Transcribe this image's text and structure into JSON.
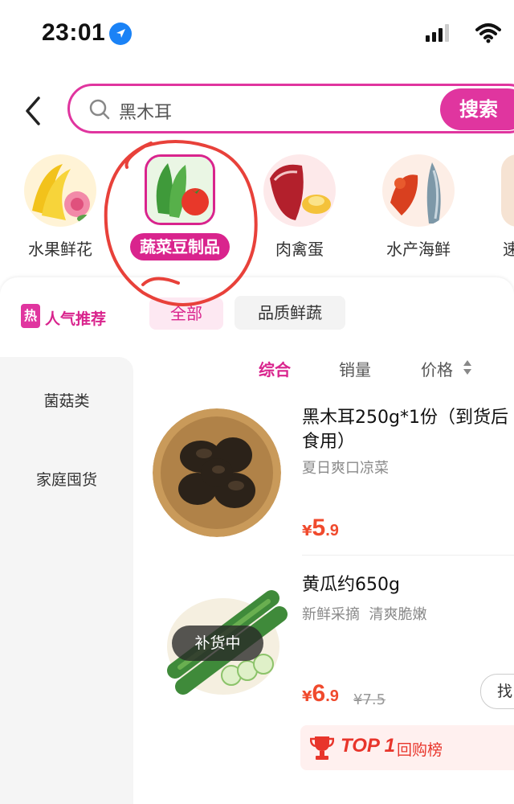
{
  "status_bar": {
    "time": "23:01"
  },
  "search": {
    "query": "黑木耳",
    "button_label": "搜索"
  },
  "categories": [
    {
      "label": "水果鲜花"
    },
    {
      "label": "蔬菜豆制品",
      "active": true
    },
    {
      "label": "肉禽蛋"
    },
    {
      "label": "水产海鲜"
    },
    {
      "label": "速"
    }
  ],
  "hot": {
    "badge": "热",
    "title": "人气推荐"
  },
  "tabs": [
    {
      "label": "全部",
      "active": true
    },
    {
      "label": "品质鲜蔬"
    }
  ],
  "sidebar": [
    {
      "label": "菌菇类"
    },
    {
      "label": "家庭囤货"
    }
  ],
  "sort": {
    "all": "综合",
    "sales": "销量",
    "price": "价格"
  },
  "products": [
    {
      "title_line1": "黑木耳250g*1份（到货后",
      "title_line2": "食用）",
      "subtitle": "夏日爽口凉菜",
      "currency": "¥",
      "price_int": "5",
      "price_dec": ".9"
    },
    {
      "title_line1": "黄瓜约650g",
      "subtitle": "新鲜采摘  清爽脆嫩",
      "currency": "¥",
      "price_int": "6",
      "price_dec": ".9",
      "old_price": "¥7.5",
      "overlay": "补货中",
      "action": "找",
      "rank": "TOP 1",
      "rank_label": "回购榜"
    }
  ],
  "colors": {
    "accent": "#e0359f",
    "price": "#f04a2d",
    "annotation": "#e8413a"
  }
}
